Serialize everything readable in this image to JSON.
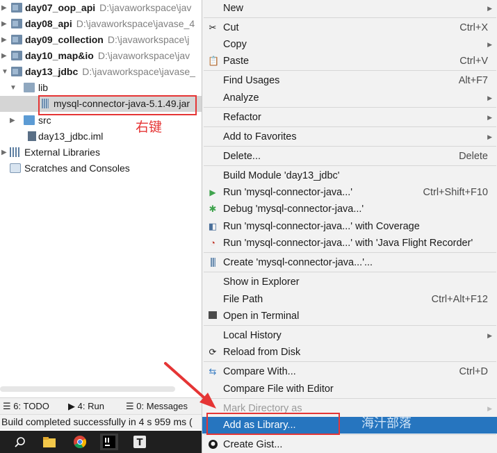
{
  "tree": {
    "modules": [
      {
        "name": "day07_oop_api",
        "path": "D:\\javaworkspace\\jav"
      },
      {
        "name": "day08_api",
        "path": "D:\\javaworkspace\\javase_4"
      },
      {
        "name": "day09_collection",
        "path": "D:\\javaworkspace\\j"
      },
      {
        "name": "day10_map&io",
        "path": "D:\\javaworkspace\\jav"
      },
      {
        "name": "day13_jdbc",
        "path": "D:\\javaworkspace\\javase_"
      }
    ],
    "lib_folder": "lib",
    "jar_file": "mysql-connector-java-5.1.49.jar",
    "src_folder": "src",
    "iml_file": "day13_jdbc.iml",
    "external_libraries": "External Libraries",
    "scratches": "Scratches and Consoles"
  },
  "annotation": "右键",
  "tool_windows": {
    "todo": "6: TODO",
    "run": "4: Run",
    "messages": "0: Messages"
  },
  "status_text": "Build completed successfully in 4 s 959 ms (",
  "menu": {
    "new": "New",
    "cut": "Cut",
    "cut_sc": "Ctrl+X",
    "copy": "Copy",
    "paste": "Paste",
    "paste_sc": "Ctrl+V",
    "find_usages": "Find Usages",
    "find_usages_sc": "Alt+F7",
    "analyze": "Analyze",
    "refactor": "Refactor",
    "add_favorites": "Add to Favorites",
    "delete": "Delete...",
    "delete_sc": "Delete",
    "build_module": "Build Module 'day13_jdbc'",
    "run": "Run 'mysql-connector-java...'",
    "run_sc": "Ctrl+Shift+F10",
    "debug": "Debug 'mysql-connector-java...'",
    "run_coverage": "Run 'mysql-connector-java...' with Coverage",
    "run_jfr": "Run 'mysql-connector-java...' with 'Java Flight Recorder'",
    "create": "Create 'mysql-connector-java...'...",
    "show_explorer": "Show in Explorer",
    "file_path": "File Path",
    "file_path_sc": "Ctrl+Alt+F12",
    "open_terminal": "Open in Terminal",
    "local_history": "Local History",
    "reload": "Reload from Disk",
    "compare_with": "Compare With...",
    "compare_with_sc": "Ctrl+D",
    "compare_editor": "Compare File with Editor",
    "mark_directory": "Mark Directory as",
    "add_library": "Add as Library...",
    "create_gist": "Create Gist..."
  },
  "watermark": "海汁部落",
  "colors": {
    "highlight": "#2675bf",
    "annotation_red": "#e53535",
    "run_green": "#3fa34d"
  }
}
